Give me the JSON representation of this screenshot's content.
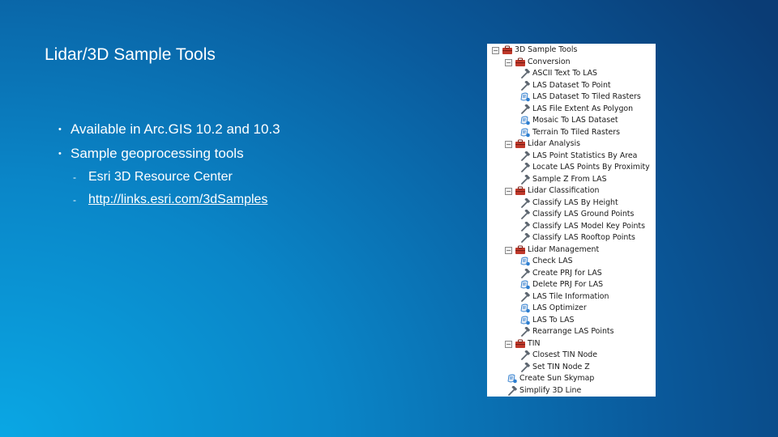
{
  "slide": {
    "title": "Lidar/3D Sample Tools",
    "bullets": [
      {
        "text": "Available in Arc.GIS 10.2 and 10.3",
        "marker": "•"
      },
      {
        "text": "Sample geoprocessing tools",
        "marker": "•"
      }
    ],
    "sub_bullets": [
      {
        "text": "Esri 3D Resource Center",
        "marker": "-"
      },
      {
        "text": "http://links.esri.com/3dSamples",
        "marker": "-"
      }
    ]
  },
  "toolbox": {
    "root": {
      "label": "3D Sample Tools",
      "expander": "−"
    },
    "groups": [
      {
        "label": "Conversion",
        "expander": "−",
        "items": [
          {
            "label": "ASCII Text To LAS",
            "icon": "hammer-icon"
          },
          {
            "label": "LAS Dataset To Point",
            "icon": "hammer-icon"
          },
          {
            "label": "LAS Dataset To Tiled Rasters",
            "icon": "script-icon"
          },
          {
            "label": "LAS File Extent As Polygon",
            "icon": "hammer-icon"
          },
          {
            "label": "Mosaic To LAS Dataset",
            "icon": "script-icon"
          },
          {
            "label": "Terrain To Tiled Rasters",
            "icon": "script-icon"
          }
        ]
      },
      {
        "label": "Lidar Analysis",
        "expander": "−",
        "items": [
          {
            "label": "LAS Point Statistics By Area",
            "icon": "hammer-icon"
          },
          {
            "label": "Locate LAS Points By Proximity",
            "icon": "hammer-icon"
          },
          {
            "label": "Sample Z From LAS",
            "icon": "hammer-icon"
          }
        ]
      },
      {
        "label": "Lidar Classification",
        "expander": "−",
        "items": [
          {
            "label": "Classify LAS By Height",
            "icon": "hammer-icon"
          },
          {
            "label": "Classify LAS Ground Points",
            "icon": "hammer-icon"
          },
          {
            "label": "Classify LAS Model Key Points",
            "icon": "hammer-icon"
          },
          {
            "label": "Classify LAS Rooftop Points",
            "icon": "hammer-icon"
          }
        ]
      },
      {
        "label": "Lidar Management",
        "expander": "−",
        "items": [
          {
            "label": "Check LAS",
            "icon": "script-icon"
          },
          {
            "label": "Create PRJ for LAS",
            "icon": "hammer-icon"
          },
          {
            "label": "Delete PRJ For LAS",
            "icon": "script-icon"
          },
          {
            "label": "LAS Tile Information",
            "icon": "hammer-icon"
          },
          {
            "label": "LAS Optimizer",
            "icon": "script-icon"
          },
          {
            "label": "LAS To LAS",
            "icon": "script-icon"
          },
          {
            "label": "Rearrange LAS Points",
            "icon": "hammer-icon"
          }
        ]
      },
      {
        "label": "TIN",
        "expander": "−",
        "items": [
          {
            "label": "Closest TIN Node",
            "icon": "hammer-icon"
          },
          {
            "label": "Set TIN Node Z",
            "icon": "hammer-icon"
          }
        ]
      }
    ],
    "root_items": [
      {
        "label": "Create Sun Skymap",
        "icon": "script-icon"
      },
      {
        "label": "Simplify 3D Line",
        "icon": "hammer-icon"
      }
    ]
  },
  "colors": {
    "bg_light": "#0aa7e4",
    "bg_dark": "#0a3c75",
    "toolbox_red": "#c0392b",
    "hammer_gray": "#5d6670",
    "script_blue": "#2f7fd0"
  }
}
